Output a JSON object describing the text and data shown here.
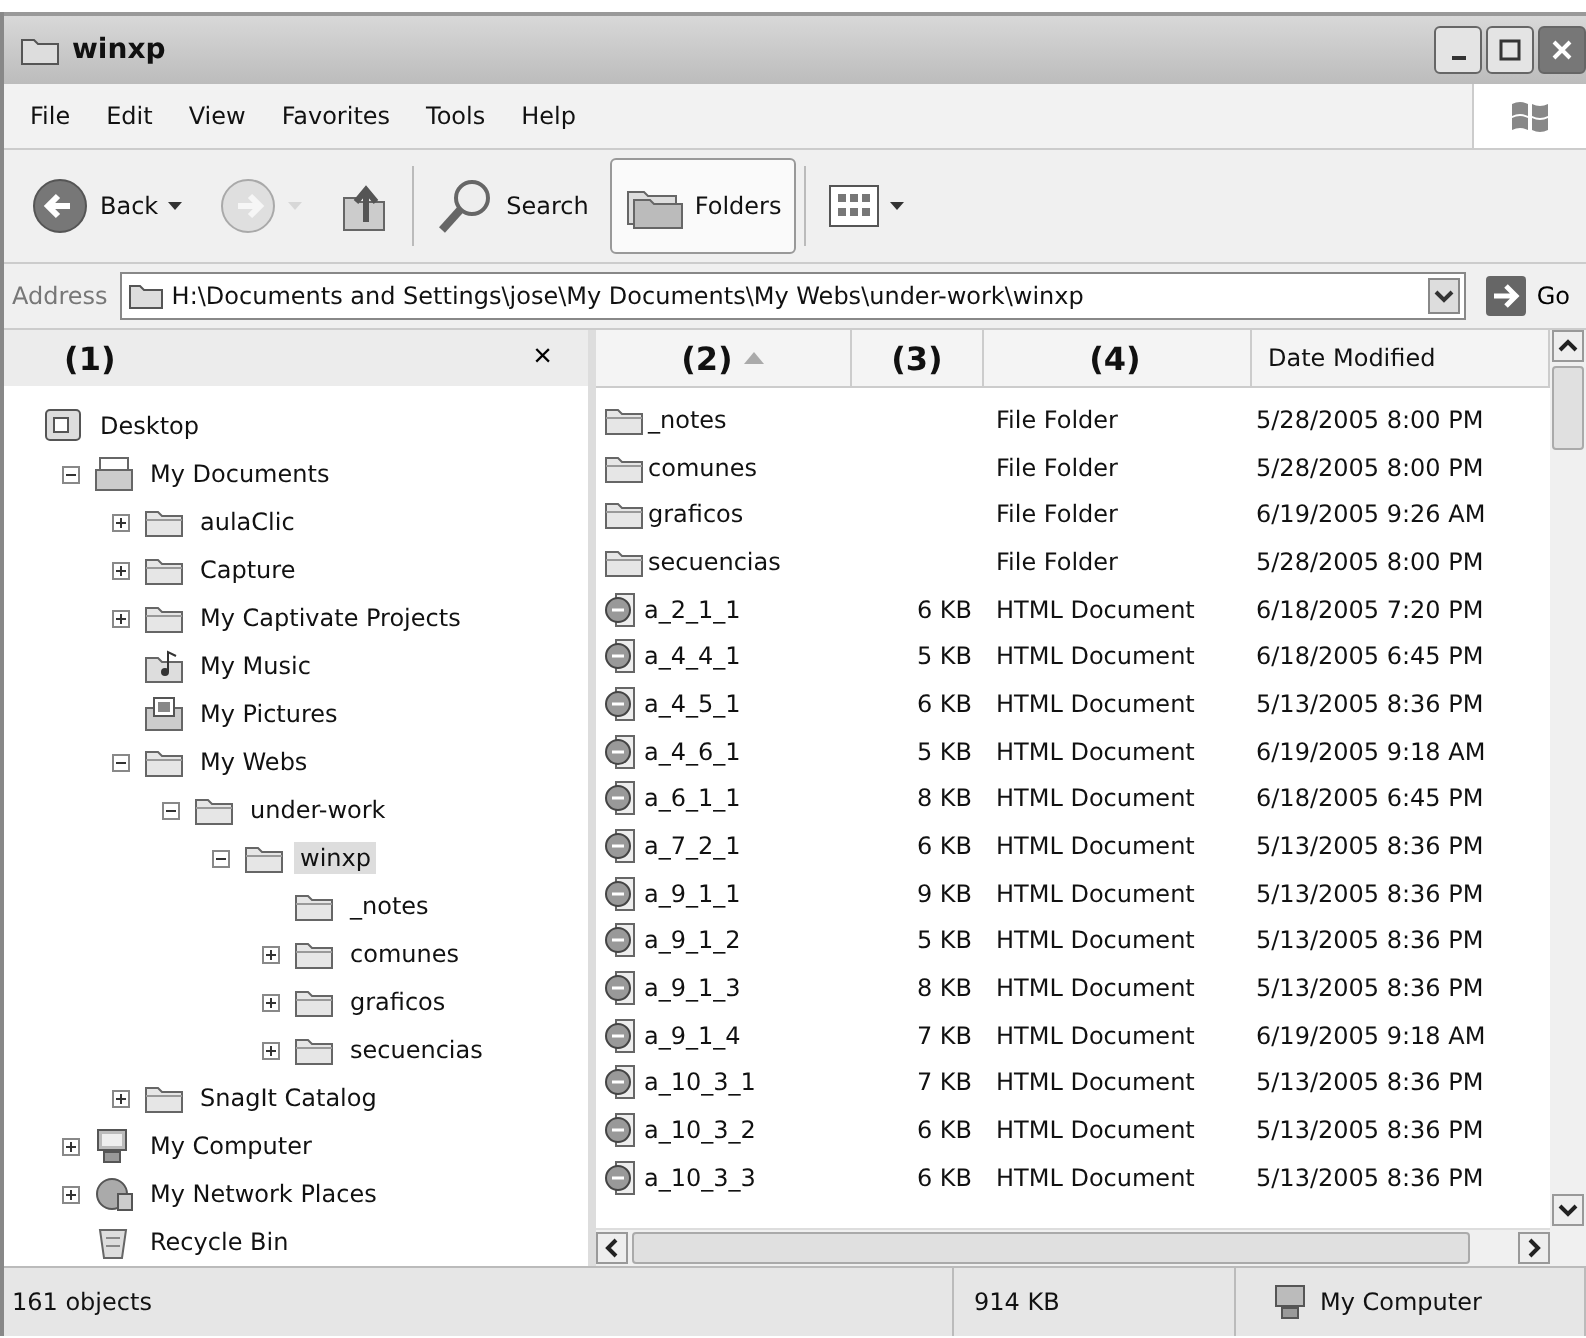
{
  "window": {
    "title": "winxp"
  },
  "menu": [
    "File",
    "Edit",
    "View",
    "Favorites",
    "Tools",
    "Help"
  ],
  "toolbar": [
    {
      "kind": "back",
      "label": "Back",
      "disabled": false,
      "pressed": false
    },
    {
      "kind": "forward",
      "disabled": true,
      "pressed": false
    },
    {
      "kind": "up",
      "disabled": false,
      "pressed": false
    },
    {
      "kind": "search",
      "label": "Search",
      "disabled": false,
      "pressed": false
    },
    {
      "kind": "folders",
      "label": "Folders",
      "disabled": false,
      "pressed": true
    },
    {
      "kind": "views",
      "disabled": false,
      "pressed": false
    }
  ],
  "address": {
    "label": "Address",
    "value": "H:\\Documents and Settings\\jose\\My Documents\\My Webs\\under-work\\winxp",
    "go": "Go"
  },
  "folders_pane": {
    "title": "(1)",
    "close": "×"
  },
  "tree": [
    {
      "label": "Desktop",
      "kind": "desktop",
      "selected": false,
      "children": [
        {
          "label": "My Documents",
          "kind": "documents",
          "toggle": true,
          "expanded": true,
          "selected": false,
          "children": [
            {
              "label": "aulaClic",
              "kind": "folder",
              "toggle": true,
              "expanded": false,
              "selected": false
            },
            {
              "label": "Capture",
              "kind": "folder",
              "toggle": true,
              "expanded": false,
              "selected": false
            },
            {
              "label": "My Captivate Projects",
              "kind": "folder",
              "toggle": true,
              "expanded": false,
              "selected": false
            },
            {
              "label": "My Music",
              "kind": "music",
              "toggle": false,
              "selected": false
            },
            {
              "label": "My Pictures",
              "kind": "pictures",
              "toggle": false,
              "selected": false
            },
            {
              "label": "My Webs",
              "kind": "folder",
              "toggle": true,
              "expanded": true,
              "selected": false,
              "children": [
                {
                  "label": "under-work",
                  "kind": "folder",
                  "toggle": true,
                  "expanded": true,
                  "selected": false,
                  "children": [
                    {
                      "label": "winxp",
                      "kind": "folder",
                      "toggle": true,
                      "expanded": true,
                      "selected": true,
                      "children": [
                        {
                          "label": "_notes",
                          "kind": "folder",
                          "toggle": false,
                          "selected": false
                        },
                        {
                          "label": "comunes",
                          "kind": "folder",
                          "toggle": true,
                          "expanded": false,
                          "selected": false
                        },
                        {
                          "label": "graficos",
                          "kind": "folder",
                          "toggle": true,
                          "expanded": false,
                          "selected": false
                        },
                        {
                          "label": "secuencias",
                          "kind": "folder",
                          "toggle": true,
                          "expanded": false,
                          "selected": false
                        }
                      ]
                    }
                  ]
                }
              ]
            },
            {
              "label": "SnagIt Catalog",
              "kind": "folder",
              "toggle": true,
              "expanded": false,
              "selected": false
            }
          ]
        },
        {
          "label": "My Computer",
          "kind": "computer",
          "toggle": true,
          "expanded": false,
          "selected": false
        },
        {
          "label": "My Network Places",
          "kind": "network",
          "toggle": true,
          "expanded": false,
          "selected": false
        },
        {
          "label": "Recycle Bin",
          "kind": "recycle",
          "toggle": false,
          "selected": false
        }
      ]
    }
  ],
  "table": {
    "columns": [
      {
        "label": "(2)",
        "sorted": true
      },
      {
        "label": "(3)",
        "sorted": false
      },
      {
        "label": "(4)",
        "sorted": false
      },
      {
        "label": "Date Modified",
        "sorted": false
      }
    ],
    "rows": [
      {
        "kind": "folder",
        "name": "_notes",
        "type": "File Folder",
        "date": "5/28/2005 8:00 PM"
      },
      {
        "kind": "folder",
        "name": "comunes",
        "type": "File Folder",
        "date": "5/28/2005 8:00 PM"
      },
      {
        "kind": "folder",
        "name": "graficos",
        "type": "File Folder",
        "date": "6/19/2005 9:26 AM"
      },
      {
        "kind": "folder",
        "name": "secuencias",
        "type": "File Folder",
        "date": "5/28/2005 8:00 PM"
      },
      {
        "kind": "html",
        "name": "a_2_1_1",
        "size": "6 KB",
        "type": "HTML Document",
        "date": "6/18/2005 7:20 PM"
      },
      {
        "kind": "html",
        "name": "a_4_4_1",
        "size": "5 KB",
        "type": "HTML Document",
        "date": "6/18/2005 6:45 PM"
      },
      {
        "kind": "html",
        "name": "a_4_5_1",
        "size": "6 KB",
        "type": "HTML Document",
        "date": "5/13/2005 8:36 PM"
      },
      {
        "kind": "html",
        "name": "a_4_6_1",
        "size": "5 KB",
        "type": "HTML Document",
        "date": "6/19/2005 9:18 AM"
      },
      {
        "kind": "html",
        "name": "a_6_1_1",
        "size": "8 KB",
        "type": "HTML Document",
        "date": "6/18/2005 6:45 PM"
      },
      {
        "kind": "html",
        "name": "a_7_2_1",
        "size": "6 KB",
        "type": "HTML Document",
        "date": "5/13/2005 8:36 PM"
      },
      {
        "kind": "html",
        "name": "a_9_1_1",
        "size": "9 KB",
        "type": "HTML Document",
        "date": "5/13/2005 8:36 PM"
      },
      {
        "kind": "html",
        "name": "a_9_1_2",
        "size": "5 KB",
        "type": "HTML Document",
        "date": "5/13/2005 8:36 PM"
      },
      {
        "kind": "html",
        "name": "a_9_1_3",
        "size": "8 KB",
        "type": "HTML Document",
        "date": "5/13/2005 8:36 PM"
      },
      {
        "kind": "html",
        "name": "a_9_1_4",
        "size": "7 KB",
        "type": "HTML Document",
        "date": "6/19/2005 9:18 AM"
      },
      {
        "kind": "html",
        "name": "a_10_3_1",
        "size": "7 KB",
        "type": "HTML Document",
        "date": "5/13/2005 8:36 PM"
      },
      {
        "kind": "html",
        "name": "a_10_3_2",
        "size": "6 KB",
        "type": "HTML Document",
        "date": "5/13/2005 8:36 PM"
      },
      {
        "kind": "html",
        "name": "a_10_3_3",
        "size": "6 KB",
        "type": "HTML Document",
        "date": "5/13/2005 8:36 PM"
      }
    ]
  },
  "status_bar": {
    "objects": "161 objects",
    "size": "914 KB",
    "zone": "My Computer"
  }
}
